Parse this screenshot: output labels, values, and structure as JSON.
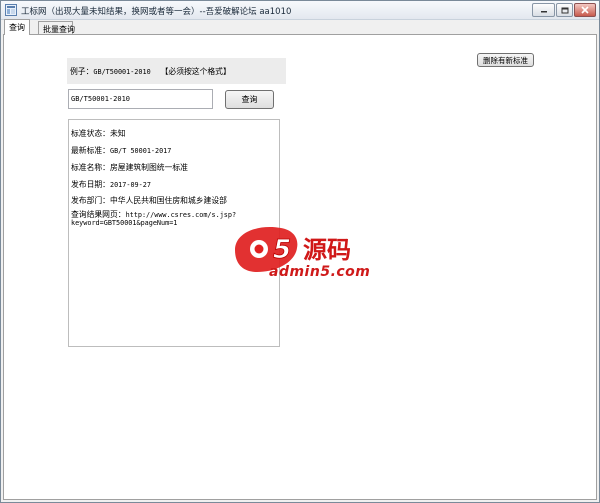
{
  "window": {
    "title": "工标网（出现大量未知结果，换网或者等一会）--吾爱破解论坛 aa1010"
  },
  "tabs": [
    {
      "label": "查询",
      "active": true
    },
    {
      "label": "批量查询",
      "active": false
    }
  ],
  "example": {
    "prefix": "例子：",
    "code": "GB/T50001-2010",
    "note": "【必须按这个格式】"
  },
  "search": {
    "value": "GB/T50001-2010",
    "button_label": "查询"
  },
  "delete_button_label": "删除有新标准",
  "result": {
    "status": {
      "label": "标准状态：",
      "value": "未知"
    },
    "latest": {
      "label": "最新标准：",
      "value": "GB/T 50001-2017"
    },
    "name": {
      "label": "标准名称：",
      "value": "房屋建筑制图统一标准"
    },
    "date": {
      "label": "发布日期：",
      "value": "2017-09-27"
    },
    "dept": {
      "label": "发布部门：",
      "value": "中华人民共和国住房和城乡建设部"
    },
    "url": {
      "label": "查询结果网页：",
      "value_line1": "http://www.csres.com/s.jsp?",
      "value_line2": "keyword=GBT50001&pageNum=1"
    }
  },
  "watermark": {
    "brand": "源码",
    "site": "admin5.com"
  },
  "colors": {
    "watermark_red": "#cf1a1a",
    "close_button": "#c75a4d"
  }
}
